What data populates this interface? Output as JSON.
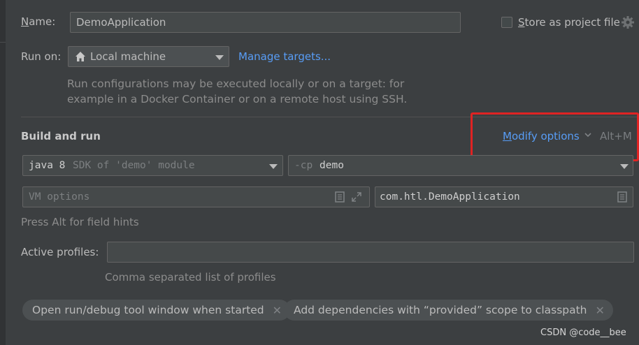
{
  "name_row": {
    "label": "Name:",
    "value": "DemoApplication",
    "store_label": "Store as project file"
  },
  "run_on": {
    "label": "Run on:",
    "selected": "Local machine",
    "manage_targets": "Manage targets...",
    "description_line1": "Run configurations may be executed locally or on a target: for",
    "description_line2": "example in a Docker Container or on a remote host using SSH."
  },
  "build": {
    "title": "Build and run",
    "modify_options": "Modify options",
    "shortcut": "Alt+M",
    "sdk_main": "java 8",
    "sdk_sub": "SDK of 'demo' module",
    "cp_prefix": "-cp",
    "cp_value": "demo",
    "vm_placeholder": "VM options",
    "main_class": "com.htl.DemoApplication",
    "field_hint": "Press Alt for field hints"
  },
  "profiles": {
    "label": "Active profiles:",
    "value": "",
    "hint": "Comma separated list of profiles"
  },
  "chips": [
    {
      "label": "Open run/debug tool window when started"
    },
    {
      "label": "Add dependencies with “provided” scope to classpath"
    }
  ],
  "watermark": "CSDN @code__bee",
  "colors": {
    "background": "#3c3f41",
    "link": "#589df6",
    "highlight_box": "#e02323"
  }
}
